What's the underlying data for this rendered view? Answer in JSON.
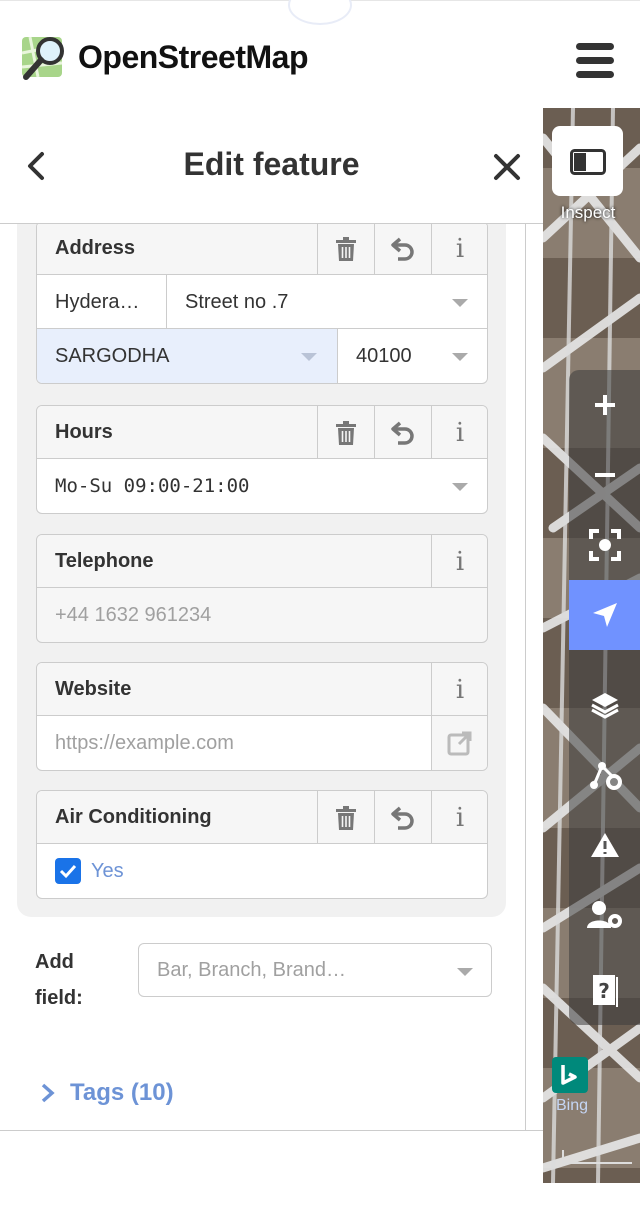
{
  "app": {
    "title": "OpenStreetMap"
  },
  "panel": {
    "title": "Edit feature",
    "fields": {
      "address": {
        "label": "Address",
        "city_value": "Hydera…",
        "street_value": "Street no .7",
        "district_value": "SARGODHA",
        "postcode_value": "40100"
      },
      "hours": {
        "label": "Hours",
        "value": "Mo-Su 09:00-21:00"
      },
      "telephone": {
        "label": "Telephone",
        "placeholder": "+44 1632 961234"
      },
      "website": {
        "label": "Website",
        "placeholder": "https://example.com"
      },
      "air_conditioning": {
        "label": "Air Conditioning",
        "checkbox_label": "Yes",
        "checked": true
      }
    },
    "add_field": {
      "label": "Add field:",
      "placeholder": "Bar, Branch, Brand…"
    },
    "tags": {
      "label": "Tags (10)"
    }
  },
  "map": {
    "inspect_label": "Inspect",
    "imagery_label": "Bing",
    "colors": {
      "accent": "#7092ff",
      "district_highlight": "#e8effc",
      "tags_link": "#6d93d6"
    }
  }
}
